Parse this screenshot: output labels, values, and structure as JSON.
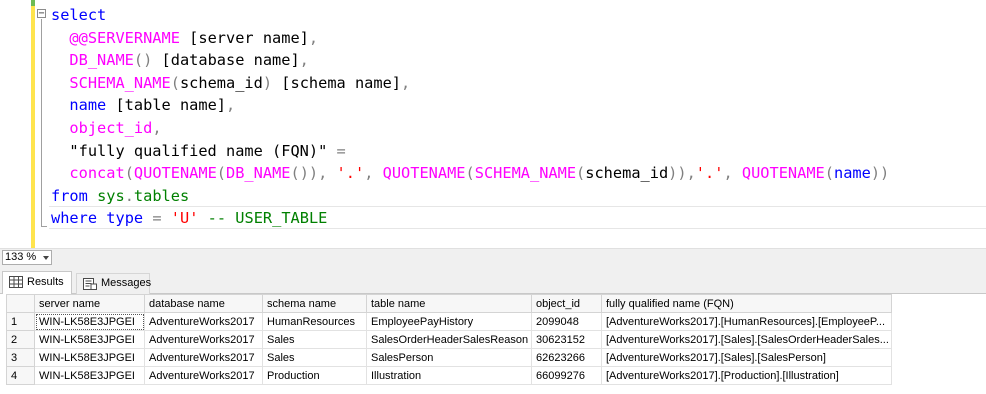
{
  "editor": {
    "lines": [
      [
        [
          "kw",
          "select"
        ]
      ],
      [
        [
          "tx",
          "  "
        ],
        [
          "fn",
          "@@SERVERNAME"
        ],
        [
          "tx",
          " [server name]"
        ],
        [
          "op",
          ","
        ]
      ],
      [
        [
          "tx",
          "  "
        ],
        [
          "fn",
          "DB_NAME"
        ],
        [
          "op",
          "()"
        ],
        [
          "tx",
          " [database name]"
        ],
        [
          "op",
          ","
        ]
      ],
      [
        [
          "tx",
          "  "
        ],
        [
          "fn",
          "SCHEMA_NAME"
        ],
        [
          "op",
          "("
        ],
        [
          "tx",
          "schema_id"
        ],
        [
          "op",
          ")"
        ],
        [
          "tx",
          " [schema name]"
        ],
        [
          "op",
          ","
        ]
      ],
      [
        [
          "tx",
          "  "
        ],
        [
          "kw",
          "name"
        ],
        [
          "tx",
          " [table name]"
        ],
        [
          "op",
          ","
        ]
      ],
      [
        [
          "tx",
          "  "
        ],
        [
          "fn",
          "object_id"
        ],
        [
          "op",
          ","
        ]
      ],
      [
        [
          "tx",
          "  \"fully qualified name (FQN)\" "
        ],
        [
          "op",
          "="
        ]
      ],
      [
        [
          "tx",
          "  "
        ],
        [
          "fn",
          "concat"
        ],
        [
          "op",
          "("
        ],
        [
          "fn",
          "QUOTENAME"
        ],
        [
          "op",
          "("
        ],
        [
          "fn",
          "DB_NAME"
        ],
        [
          "op",
          "()),"
        ],
        [
          "tx",
          " "
        ],
        [
          "st",
          "'.'"
        ],
        [
          "op",
          ","
        ],
        [
          "tx",
          " "
        ],
        [
          "fn",
          "QUOTENAME"
        ],
        [
          "op",
          "("
        ],
        [
          "fn",
          "SCHEMA_NAME"
        ],
        [
          "op",
          "("
        ],
        [
          "tx",
          "schema_id"
        ],
        [
          "op",
          "))"
        ],
        [
          "op",
          ","
        ],
        [
          "st",
          "'.'"
        ],
        [
          "op",
          ","
        ],
        [
          "tx",
          " "
        ],
        [
          "fn",
          "QUOTENAME"
        ],
        [
          "op",
          "("
        ],
        [
          "kw",
          "name"
        ],
        [
          "op",
          "))"
        ]
      ],
      [
        [
          "kw",
          "from"
        ],
        [
          "tx",
          " "
        ],
        [
          "gr",
          "sys"
        ],
        [
          "op",
          "."
        ],
        [
          "gr",
          "tables"
        ]
      ],
      [
        [
          "kw",
          "where"
        ],
        [
          "tx",
          " "
        ],
        [
          "kw",
          "type"
        ],
        [
          "tx",
          " "
        ],
        [
          "op",
          "="
        ],
        [
          "tx",
          " "
        ],
        [
          "st",
          "'U'"
        ],
        [
          "tx",
          " "
        ],
        [
          "gr",
          "-- USER_TABLE"
        ]
      ]
    ]
  },
  "zoom": {
    "value": "133 %"
  },
  "tabs": {
    "results": "Results",
    "messages": "Messages"
  },
  "grid": {
    "columns": [
      "",
      "server name",
      "database name",
      "schema name",
      "table name",
      "object_id",
      "fully qualified name (FQN)"
    ],
    "rows": [
      [
        "1",
        "WIN-LK58E3JPGEI",
        "AdventureWorks2017",
        "HumanResources",
        "EmployeePayHistory",
        "2099048",
        "[AdventureWorks2017].[HumanResources].[EmployeeP..."
      ],
      [
        "2",
        "WIN-LK58E3JPGEI",
        "AdventureWorks2017",
        "Sales",
        "SalesOrderHeaderSalesReason",
        "30623152",
        "[AdventureWorks2017].[Sales].[SalesOrderHeaderSales..."
      ],
      [
        "3",
        "WIN-LK58E3JPGEI",
        "AdventureWorks2017",
        "Sales",
        "SalesPerson",
        "62623266",
        "[AdventureWorks2017].[Sales].[SalesPerson]"
      ],
      [
        "4",
        "WIN-LK58E3JPGEI",
        "AdventureWorks2017",
        "Production",
        "Illustration",
        "66099276",
        "[AdventureWorks2017].[Production].[Illustration]"
      ]
    ]
  }
}
